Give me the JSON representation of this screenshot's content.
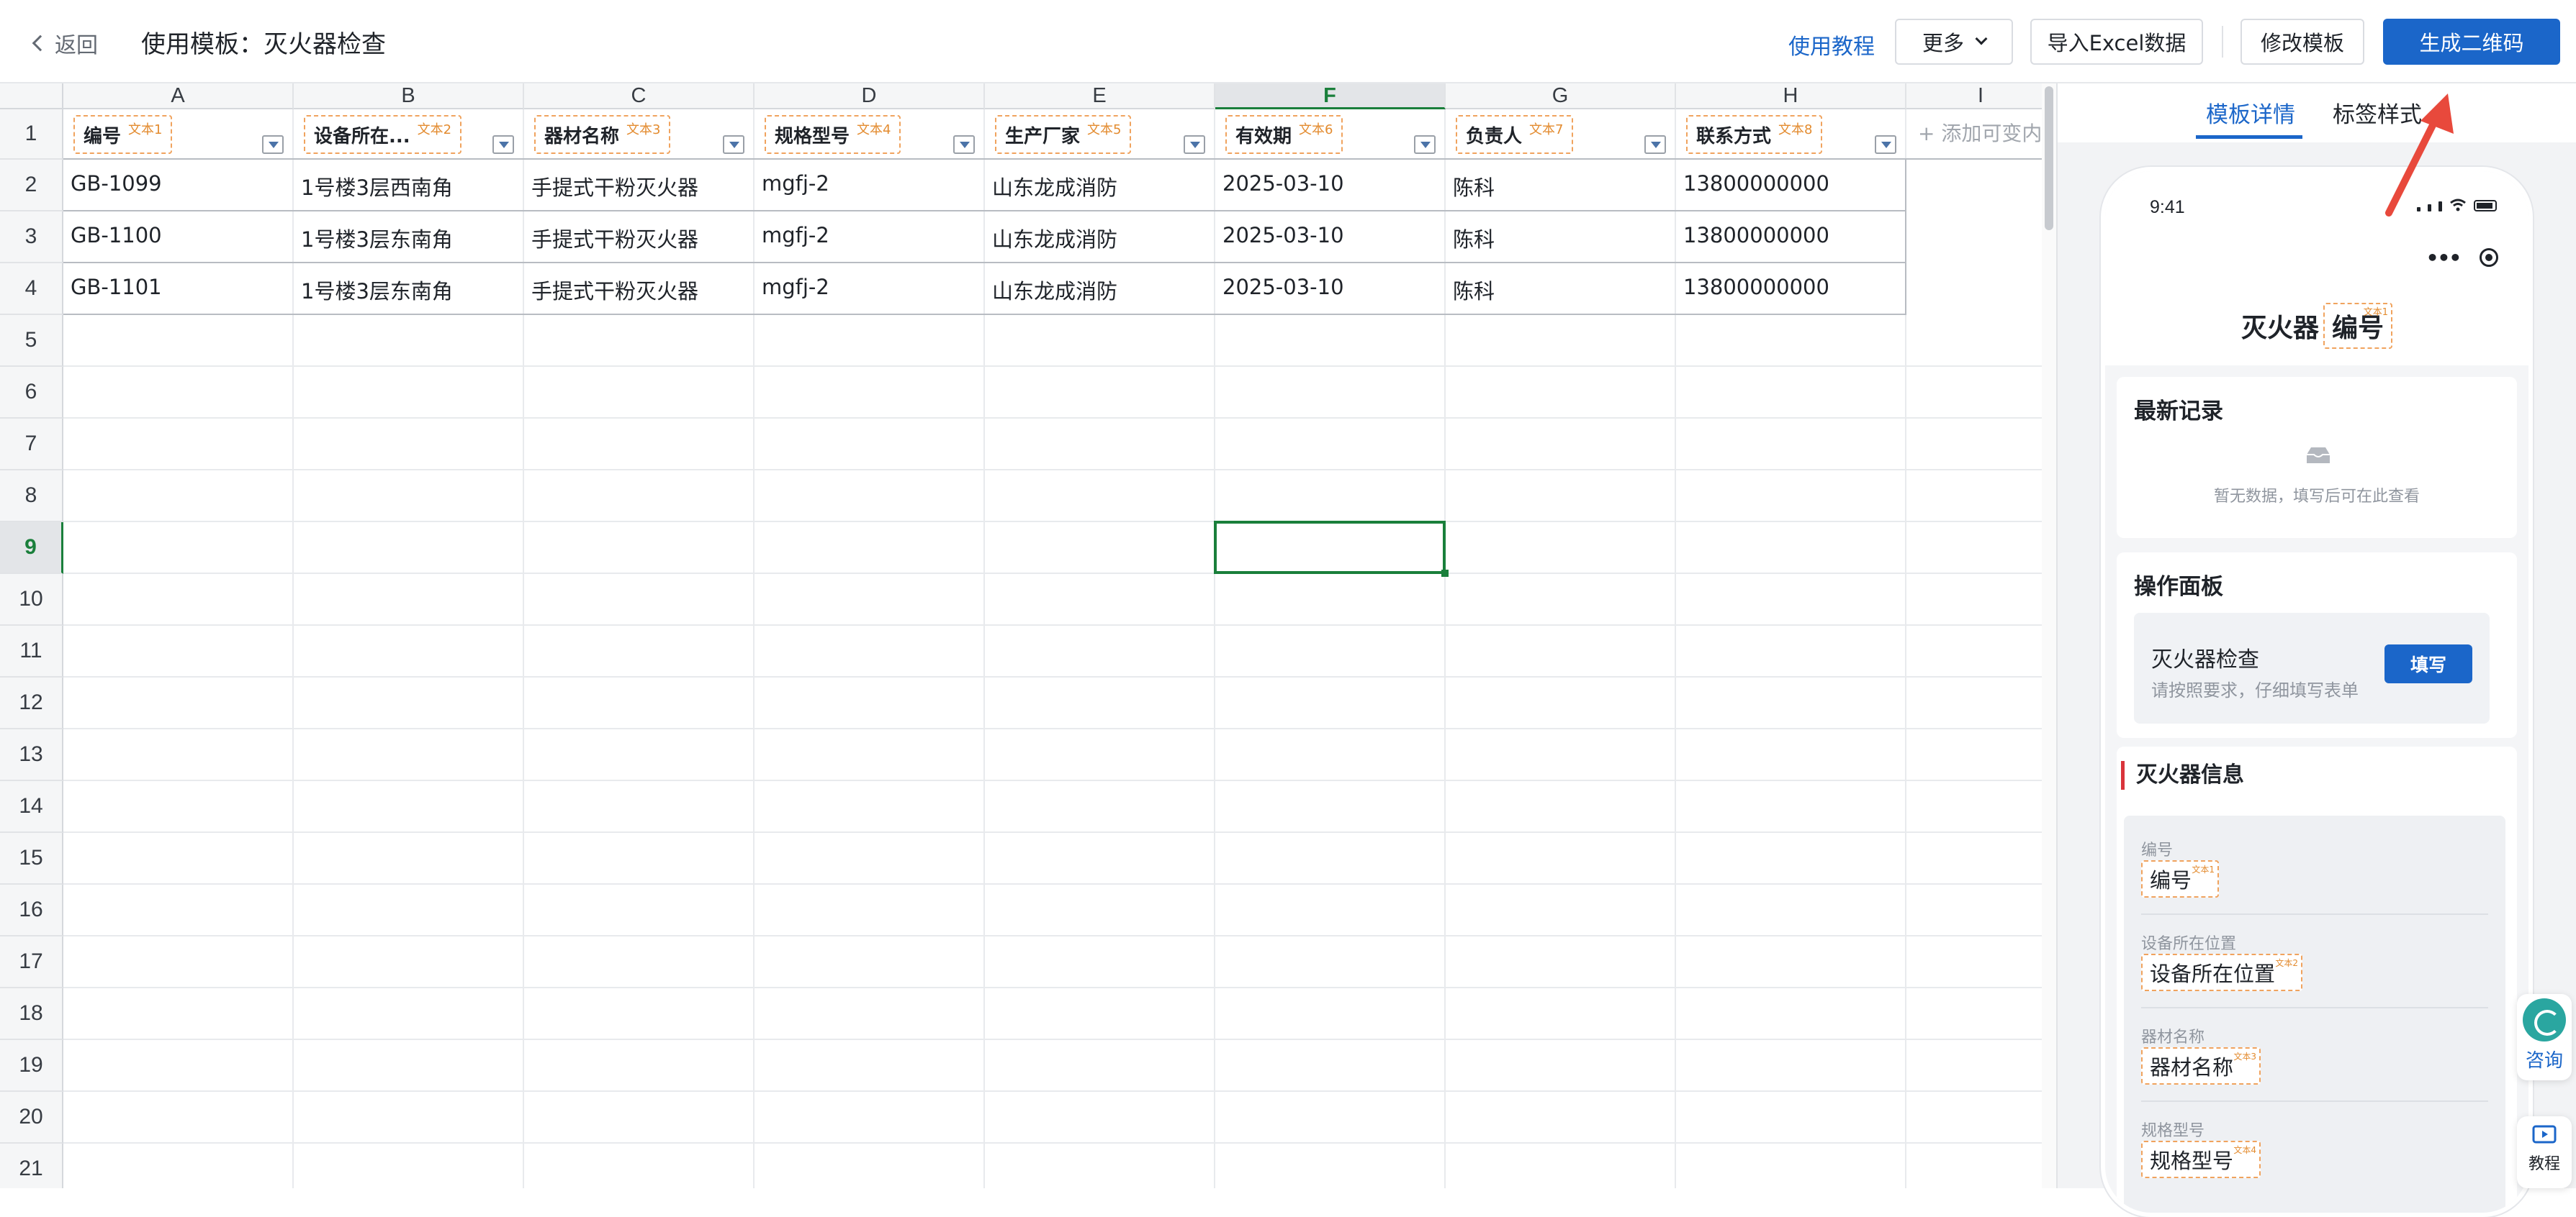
{
  "topbar": {
    "back_label": "返回",
    "title": "使用模板：灭火器检查",
    "tutorial_link": "使用教程",
    "more_label": "更多",
    "import_label": "导入Excel数据",
    "edit_template_label": "修改模板",
    "generate_qr_label": "生成二维码"
  },
  "sheet": {
    "columns": [
      "A",
      "B",
      "C",
      "D",
      "E",
      "F",
      "G",
      "H",
      "I"
    ],
    "rows": [
      "1",
      "2",
      "3",
      "4",
      "5",
      "6",
      "7",
      "8",
      "9",
      "10",
      "11",
      "12",
      "13",
      "14",
      "15",
      "16",
      "17",
      "18",
      "19",
      "20",
      "21"
    ],
    "active_column": "F",
    "active_row": "9",
    "header_tags": [
      {
        "label": "编号",
        "badge": "文本1"
      },
      {
        "label": "设备所在...",
        "badge": "文本2"
      },
      {
        "label": "器材名称",
        "badge": "文本3"
      },
      {
        "label": "规格型号",
        "badge": "文本4"
      },
      {
        "label": "生产厂家",
        "badge": "文本5"
      },
      {
        "label": "有效期",
        "badge": "文本6"
      },
      {
        "label": "负责人",
        "badge": "文本7"
      },
      {
        "label": "联系方式",
        "badge": "文本8"
      }
    ],
    "add_variable_label": "+ 添加可变内",
    "data_rows": [
      [
        "GB-1099",
        "1号楼3层西南角",
        "手提式干粉灭火器",
        "mgfj-2",
        "山东龙成消防",
        "2025-03-10",
        "陈科",
        "13800000000"
      ],
      [
        "GB-1100",
        "1号楼3层东南角",
        "手提式干粉灭火器",
        "mgfj-2",
        "山东龙成消防",
        "2025-03-10",
        "陈科",
        "13800000000"
      ],
      [
        "GB-1101",
        "1号楼3层东南角",
        "手提式干粉灭火器",
        "mgfj-2",
        "山东龙成消防",
        "2025-03-10",
        "陈科",
        "13800000000"
      ]
    ]
  },
  "panel": {
    "tab_detail": "模板详情",
    "tab_label_style": "标签样式",
    "phone": {
      "time": "9:41",
      "title_prefix": "灭火器",
      "title_tag": "编号",
      "title_tag_badge": "文本1",
      "latest_title": "最新记录",
      "empty_text": "暂无数据，填写后可在此查看",
      "ops_title": "操作面板",
      "ops_item_title": "灭火器检查",
      "ops_item_sub": "请按照要求，仔细填写表单",
      "fill_label": "填写",
      "info_title": "灭火器信息",
      "fields": [
        {
          "label": "编号",
          "tag": "编号",
          "badge": "文本1"
        },
        {
          "label": "设备所在位置",
          "tag": "设备所在位置",
          "badge": "文本2"
        },
        {
          "label": "器材名称",
          "tag": "器材名称",
          "badge": "文本3"
        },
        {
          "label": "规格型号",
          "tag": "规格型号",
          "badge": "文本4"
        }
      ]
    }
  },
  "floating": {
    "consult_label": "咨询",
    "tutorial_label": "教程"
  },
  "colors": {
    "primary": "#1b66c9",
    "active_green": "#1a7f3b",
    "tag_border": "#f0a35e",
    "arrow": "#e8493c"
  }
}
